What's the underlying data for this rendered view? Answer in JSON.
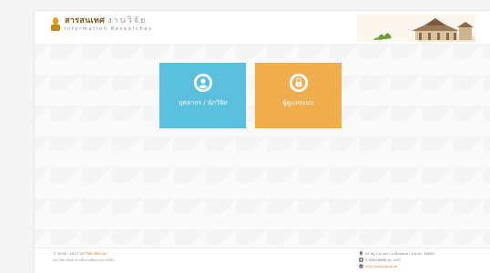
{
  "header": {
    "logo_title": "สารสนเทศ",
    "logo_title_suffix": "งานวิจัย",
    "logo_subtitle": "Information Researches"
  },
  "tiles": {
    "personnel_label": "บุคลากร / นักวิจัย",
    "admin_label": "ผู้ดูแลระบบ"
  },
  "footer": {
    "copyright_prefix": "© 2016 - 2017",
    "copyright_link": "มหาวิทยาลัยพะเยา",
    "copyright_sub": "มหาวิทยาลัยพะเยาเพื่อการพัฒนาอย่างยั่งยืน",
    "address": "19 หมู่ 2 ต.แม่กา อ.เมืองพะเยา จ.พะเยา 56000",
    "phone": "0-5446-6666 ต่อ 1027",
    "website": "http://www.up.ac.th"
  },
  "colors": {
    "personnel_tile": "#5bc0de",
    "admin_tile": "#f0ad4e",
    "link": "#e57b22"
  },
  "icons": {
    "personnel": "user-icon",
    "admin": "lock-icon",
    "address": "map-marker-icon",
    "phone": "phone-icon",
    "website": "globe-icon"
  }
}
